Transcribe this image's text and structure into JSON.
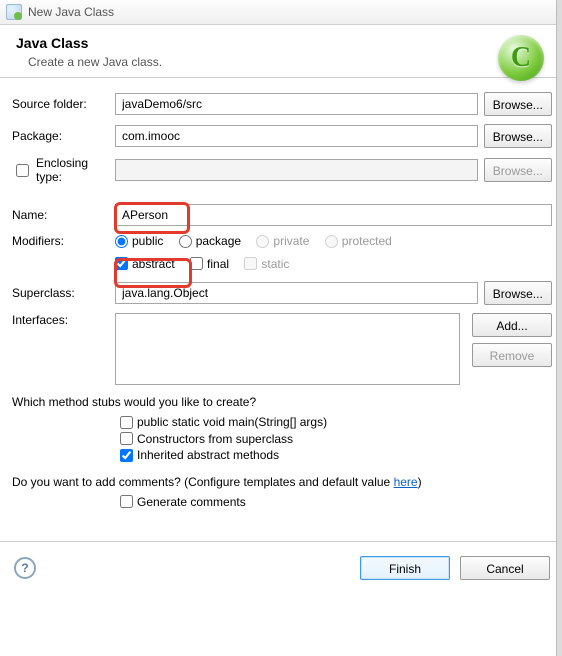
{
  "window": {
    "title": "New Java Class"
  },
  "header": {
    "title": "Java Class",
    "subtitle": "Create a new Java class."
  },
  "labels": {
    "sourceFolder": "Source folder:",
    "package": "Package:",
    "enclosingType": "Enclosing type:",
    "name": "Name:",
    "modifiers": "Modifiers:",
    "superclass": "Superclass:",
    "interfaces": "Interfaces:"
  },
  "fields": {
    "sourceFolder": "javaDemo6/src",
    "package": "com.imooc",
    "enclosingType": "",
    "name": "APerson",
    "superclass": "java.lang.Object"
  },
  "buttons": {
    "browse": "Browse...",
    "add": "Add...",
    "remove": "Remove",
    "finish": "Finish",
    "cancel": "Cancel"
  },
  "modifiers": {
    "access": {
      "public": "public",
      "package": "package",
      "private": "private",
      "protected": "protected",
      "selected": "public"
    },
    "flags": {
      "abstract": {
        "label": "abstract",
        "checked": true
      },
      "final": {
        "label": "final",
        "checked": false
      },
      "static": {
        "label": "static",
        "checked": false
      }
    }
  },
  "stubs": {
    "question": "Which method stubs would you like to create?",
    "main": {
      "label": "public static void main(String[] args)",
      "checked": false
    },
    "constructors": {
      "label": "Constructors from superclass",
      "checked": false
    },
    "inherited": {
      "label": "Inherited abstract methods",
      "checked": true
    }
  },
  "comments": {
    "question_prefix": "Do you want to add comments? (Configure templates and default value ",
    "link": "here",
    "question_suffix": ")",
    "generate": {
      "label": "Generate comments",
      "checked": false
    }
  },
  "help": "?"
}
